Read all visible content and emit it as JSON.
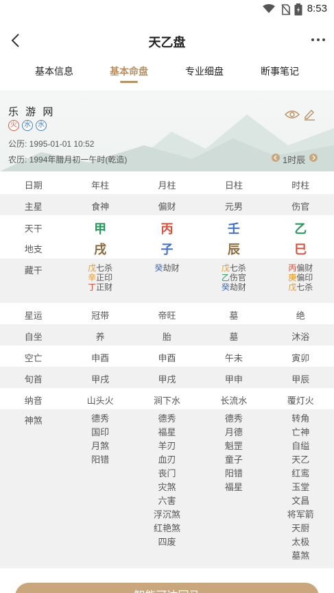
{
  "status": {
    "time": "8:53"
  },
  "nav": {
    "title": "天乙盘"
  },
  "tabs": [
    {
      "label": "基本信息"
    },
    {
      "label": "基本命盘"
    },
    {
      "label": "专业细盘"
    },
    {
      "label": "断事笔记"
    }
  ],
  "info": {
    "name": "乐 游 网",
    "elements": [
      "火",
      "水",
      "水"
    ],
    "solar": "公历: 1995-01-01 10:52",
    "lunar": "农历: 1994年腊月初一午时(乾造)",
    "hour": "1时辰"
  },
  "table": {
    "headers": [
      "日期",
      "年柱",
      "月柱",
      "日柱",
      "时柱"
    ],
    "zhuxing": {
      "label": "主星",
      "values": [
        "食神",
        "偏财",
        "元男",
        "伤官"
      ]
    },
    "tiangan": {
      "label": "天干",
      "values": [
        "甲",
        "丙",
        "壬",
        "乙"
      ]
    },
    "dizhi": {
      "label": "地支",
      "values": [
        "戌",
        "子",
        "辰",
        "巳"
      ]
    },
    "canggan": {
      "label": "藏干",
      "cols": [
        [
          {
            "g": "戊",
            "s": "七杀"
          },
          {
            "g": "辛",
            "s": "正印"
          },
          {
            "g": "丁",
            "s": "正财"
          }
        ],
        [
          {
            "g": "癸",
            "s": "劫财"
          }
        ],
        [
          {
            "g": "戊",
            "s": "七杀"
          },
          {
            "g": "乙",
            "s": "伤官"
          },
          {
            "g": "癸",
            "s": "劫财"
          }
        ],
        [
          {
            "g": "丙",
            "s": "偏财"
          },
          {
            "g": "庚",
            "s": "偏印"
          },
          {
            "g": "戊",
            "s": "七杀"
          }
        ]
      ]
    },
    "xingyun": {
      "label": "星运",
      "values": [
        "冠带",
        "帝旺",
        "墓",
        "绝"
      ]
    },
    "zizuo": {
      "label": "自坐",
      "values": [
        "养",
        "胎",
        "墓",
        "沐浴"
      ]
    },
    "kongwang": {
      "label": "空亡",
      "values": [
        "申酉",
        "申酉",
        "午未",
        "寅卯"
      ]
    },
    "xunshou": {
      "label": "旬首",
      "values": [
        "甲戌",
        "甲戌",
        "甲申",
        "甲辰"
      ]
    },
    "nayin": {
      "label": "纳音",
      "values": [
        "山头火",
        "涧下水",
        "长流水",
        "覆灯火"
      ]
    },
    "shensha": {
      "label": "神煞",
      "cols": [
        [
          "德秀",
          "国印",
          "月煞",
          "阳错"
        ],
        [
          "德秀",
          "福星",
          "羊刃",
          "血刃",
          "丧门",
          "灾煞",
          "六害",
          "浮沉煞",
          "红艳煞",
          "四废"
        ],
        [
          "德秀",
          "月德",
          "魁罡",
          "童子",
          "阳错",
          "福星"
        ],
        [
          "转角",
          "亡神",
          "自缢",
          "天乙",
          "红鸾",
          "玉堂",
          "文昌",
          "将军箭",
          "天厨",
          "太极",
          "墓煞"
        ]
      ]
    }
  },
  "bottom_button": {
    "label": "智能可达回马"
  }
}
